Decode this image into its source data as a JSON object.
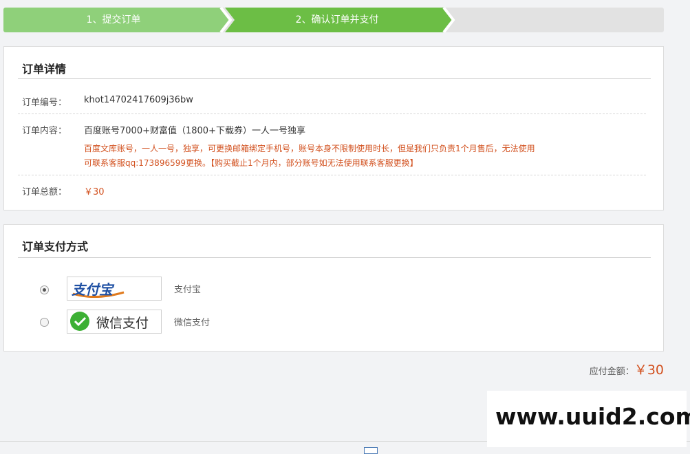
{
  "steps": [
    {
      "label": "1、提交订单"
    },
    {
      "label": "2、确认订单并支付"
    },
    {
      "label": ""
    }
  ],
  "order": {
    "title": "订单详情",
    "number_label": "订单编号：",
    "number": "khot14702417609j36bw",
    "content_label": "订单内容：",
    "content": "百度账号7000+财富值（1800+下载券）一人一号独享",
    "note_line1": "百度文库账号，一人一号，独享，可更换邮箱绑定手机号，账号本身不限制使用时长，但是我们只负责1个月售后，无法使用",
    "note_line2": "可联系客服qq:173896599更换。【购买截止1个月内，部分账号如无法使用联系客服更换】",
    "total_label": "订单总额：",
    "total": "￥30"
  },
  "payment": {
    "title": "订单支付方式",
    "methods": [
      {
        "logo_text": "支付宝",
        "name": "支付宝",
        "selected": true
      },
      {
        "logo_text": "微信支付",
        "name": "微信支付",
        "selected": false
      }
    ]
  },
  "summary": {
    "label": "应付金额：",
    "amount": "￥30"
  },
  "watermark": "www.uuid2.com",
  "colors": {
    "step_done": "#8fd07a",
    "step_active": "#6cbe45",
    "step_pending": "#e2e2e2",
    "accent_red": "#d2501e"
  }
}
